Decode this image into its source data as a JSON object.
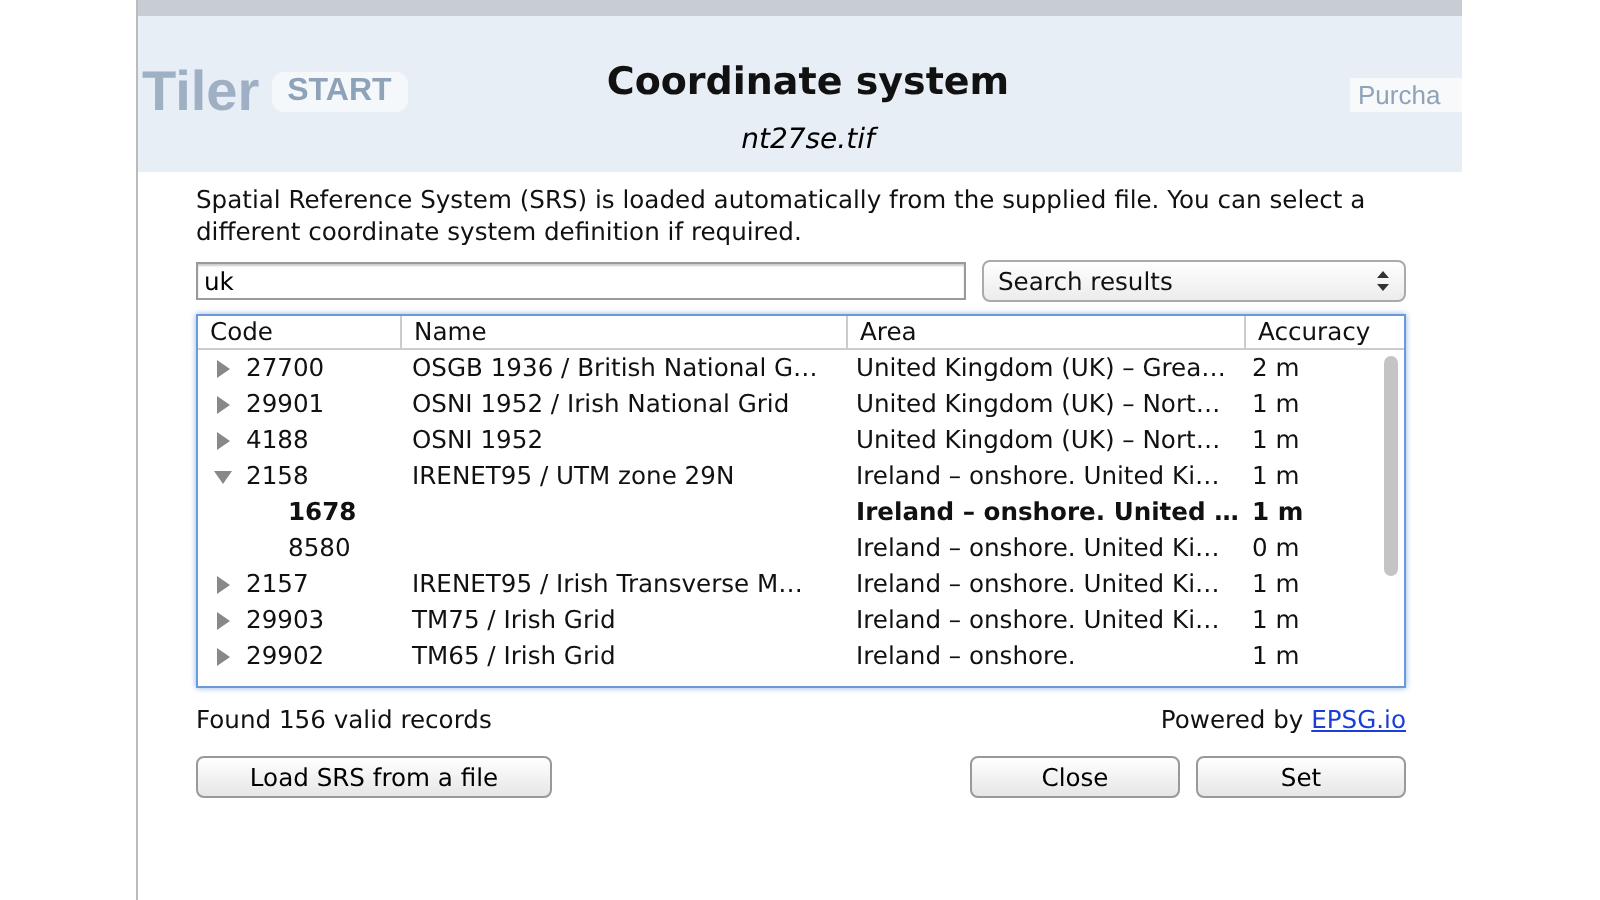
{
  "background": {
    "app_name": "Tiler",
    "badge": "START",
    "button": "Purcha"
  },
  "dialog": {
    "title": "Coordinate system",
    "filename": "nt27se.tif",
    "description": "Spatial Reference System  (SRS) is loaded automatically from the supplied file. You can select a different coordinate system definition if required.",
    "search": {
      "value": "uk"
    },
    "source_select": "Search results",
    "table": {
      "columns": [
        "Code",
        "Name",
        "Area",
        "Accuracy"
      ],
      "rows": [
        {
          "code": "27700",
          "name": "OSGB 1936 / British National G…",
          "area": "United Kingdom (UK) – Grea…",
          "accuracy": "2 m",
          "expanded": false,
          "bold": false
        },
        {
          "code": "29901",
          "name": "OSNI 1952 / Irish National Grid",
          "area": "United Kingdom (UK) – Nort…",
          "accuracy": "1 m",
          "expanded": false,
          "bold": false
        },
        {
          "code": "4188",
          "name": "OSNI 1952",
          "area": "United Kingdom (UK) – Nort…",
          "accuracy": "1 m",
          "expanded": false,
          "bold": false
        },
        {
          "code": "2158",
          "name": "IRENET95 / UTM zone 29N",
          "area": "Ireland – onshore. United Ki…",
          "accuracy": "1 m",
          "expanded": true,
          "bold": false,
          "children": [
            {
              "code": "1678",
              "area": "Ireland – onshore. United …",
              "accuracy": "1 m",
              "bold": true
            },
            {
              "code": "8580",
              "area": "Ireland – onshore. United Ki…",
              "accuracy": "0 m",
              "bold": false
            }
          ]
        },
        {
          "code": "2157",
          "name": "IRENET95 / Irish Transverse M…",
          "area": "Ireland – onshore. United Ki…",
          "accuracy": "1 m",
          "expanded": false,
          "bold": false
        },
        {
          "code": "29903",
          "name": "TM75 / Irish Grid",
          "area": "Ireland – onshore. United Ki…",
          "accuracy": "1 m",
          "expanded": false,
          "bold": false
        },
        {
          "code": "29902",
          "name": "TM65 / Irish Grid",
          "area": "Ireland – onshore.",
          "accuracy": "1 m",
          "expanded": false,
          "bold": false
        }
      ]
    },
    "status": "Found 156 valid records",
    "powered_by": "Powered by",
    "link": "EPSG.io",
    "buttons": {
      "load": "Load SRS from a file",
      "close": "Close",
      "set": "Set"
    }
  }
}
